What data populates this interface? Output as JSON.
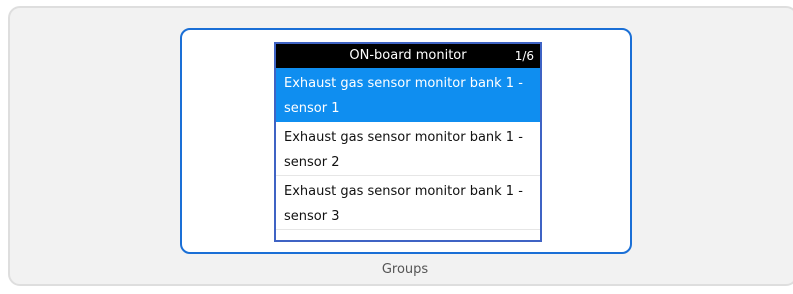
{
  "monitor": {
    "title": "ON-board monitor",
    "page_indicator": "1/6",
    "items": [
      {
        "label": "Exhaust gas sensor monitor bank 1 - sensor 1",
        "selected": true
      },
      {
        "label": "Exhaust gas sensor monitor bank 1 - sensor 2",
        "selected": false
      },
      {
        "label": "Exhaust gas sensor monitor bank 1 - sensor 3",
        "selected": false
      }
    ]
  },
  "caption": "Groups",
  "colors": {
    "header_bg": "#000000",
    "selected_bg": "#0f8ef0",
    "card_border": "#1a6fd6",
    "screen_border": "#3f63c4"
  }
}
